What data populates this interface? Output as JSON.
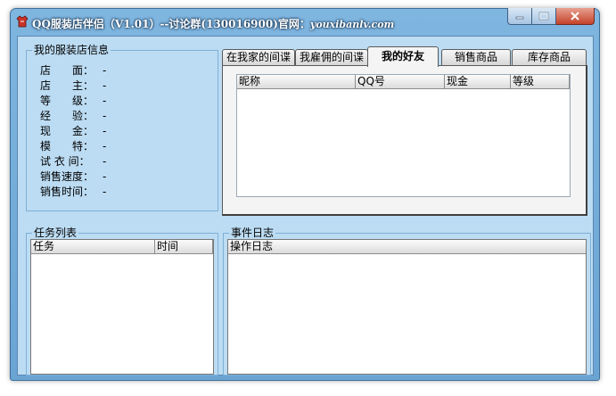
{
  "window": {
    "title": "QQ服装店伴侣（V1.01）--讨论群(130016900)官网：",
    "title_site": "youxibanlv.com",
    "controls": {
      "minimize": "minimize",
      "maximize": "maximize",
      "close": "close"
    }
  },
  "shop_info": {
    "legend": "我的服装店信息",
    "rows": [
      {
        "label": "店　　面：",
        "value": "-"
      },
      {
        "label": "店　　主：",
        "value": "-"
      },
      {
        "label": "等　　级：",
        "value": "-"
      },
      {
        "label": "经　　验：",
        "value": "-"
      },
      {
        "label": "现　　金：",
        "value": "-"
      },
      {
        "label": "模　　特：",
        "value": "-"
      },
      {
        "label": "试 衣 间：",
        "value": "-"
      },
      {
        "label": "销售速度：",
        "value": "-"
      },
      {
        "label": "销售时间：",
        "value": "-"
      }
    ]
  },
  "tabs": [
    {
      "label": "在我家的间谍",
      "active": false
    },
    {
      "label": "我雇佣的间谍",
      "active": false
    },
    {
      "label": "我的好友",
      "active": true
    },
    {
      "label": "销售商品",
      "active": false
    },
    {
      "label": "库存商品",
      "active": false
    }
  ],
  "friends_list": {
    "columns": [
      "昵称",
      "QQ号",
      "现金",
      "等级"
    ]
  },
  "task_list": {
    "legend": "任务列表",
    "columns": [
      "任务",
      "时间"
    ]
  },
  "event_log": {
    "legend": "事件日志",
    "columns": [
      "操作日志"
    ]
  }
}
